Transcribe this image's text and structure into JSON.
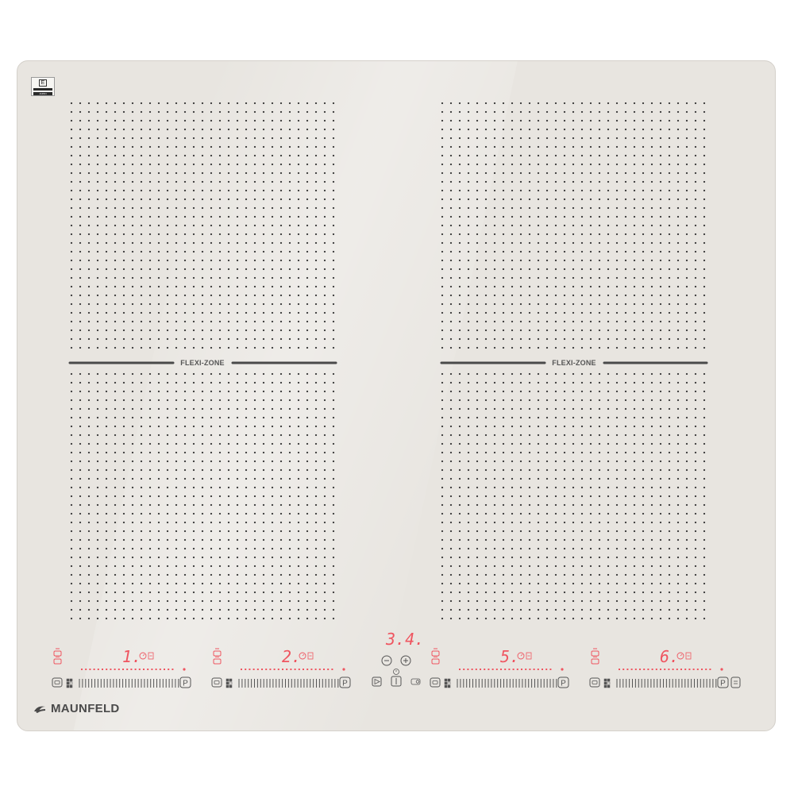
{
  "brand": {
    "name": "MAUNFELD",
    "logo_icon": "maunfeld-logo-icon"
  },
  "certification": {
    "badge_icon": "certification-mark-icon",
    "label": "JAPAN"
  },
  "colors": {
    "glass": "#e8e5e0",
    "dots": "#3a3a3a",
    "display_red": "#ef5560",
    "symbols": "#555555"
  },
  "flexi_zones": [
    {
      "label": "FLEXI-ZONE"
    },
    {
      "label": "FLEXI-ZONE"
    }
  ],
  "cooking_zones": [
    {
      "zone": "1",
      "display": "1.",
      "timer_icon": "timer-icon",
      "level_indicator_icon": "level-indicator-icon",
      "heat_icon": "pot-heat-icon",
      "warm_icon": "pot-warm-icon",
      "pause_icon": "pause-icon",
      "boost_label": "P",
      "grid_icon": "flexi-grid-icon"
    },
    {
      "zone": "2",
      "display": "2.",
      "timer_icon": "timer-icon",
      "level_indicator_icon": "level-indicator-icon",
      "heat_icon": "pot-heat-icon",
      "warm_icon": "pot-warm-icon",
      "pause_icon": "pause-icon",
      "boost_label": "P",
      "grid_icon": "flexi-grid-icon"
    },
    {
      "zone": "5",
      "display": "5.",
      "timer_icon": "timer-icon",
      "level_indicator_icon": "level-indicator-icon",
      "heat_icon": "pot-heat-icon",
      "warm_icon": "pot-warm-icon",
      "pause_icon": "pause-icon",
      "boost_label": "P",
      "grid_icon": "flexi-grid-icon"
    },
    {
      "zone": "6",
      "display": "6.",
      "timer_icon": "timer-icon",
      "level_indicator_icon": "level-indicator-icon",
      "heat_icon": "pot-heat-icon",
      "warm_icon": "pot-warm-icon",
      "pause_icon": "pause-icon",
      "boost_label": "P",
      "grid_icon": "flexi-grid-icon"
    }
  ],
  "center_controls": {
    "display": "3.4.",
    "minus_icon": "minus-icon",
    "plus_icon": "plus-icon",
    "alarm_icon": "alarm-clock-icon",
    "play_icon": "play-pause-icon",
    "power_icon": "power-icon",
    "lock_icon": "child-lock-icon"
  }
}
